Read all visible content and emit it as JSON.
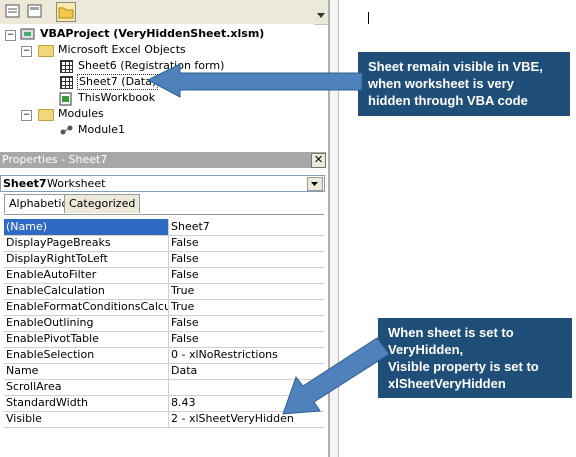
{
  "project_tree": {
    "project": "VBAProject (VeryHiddenSheet.xlsm)",
    "excel_objects_folder": "Microsoft Excel Objects",
    "items": [
      {
        "label": "Sheet6 (Registration form)"
      },
      {
        "label": "Sheet7 (Data)"
      },
      {
        "label": "ThisWorkbook"
      }
    ],
    "modules_folder": "Modules",
    "module": "Module1"
  },
  "properties": {
    "title": "Properties - Sheet7",
    "object_name": "Sheet7",
    "object_type": "Worksheet",
    "tabs": [
      "Alphabetic",
      "Categorized"
    ],
    "rows": [
      {
        "name": "(Name)",
        "value": "Sheet7"
      },
      {
        "name": "DisplayPageBreaks",
        "value": "False"
      },
      {
        "name": "DisplayRightToLeft",
        "value": "False"
      },
      {
        "name": "EnableAutoFilter",
        "value": "False"
      },
      {
        "name": "EnableCalculation",
        "value": "True"
      },
      {
        "name": "EnableFormatConditionsCalculation",
        "value": "True"
      },
      {
        "name": "EnableOutlining",
        "value": "False"
      },
      {
        "name": "EnablePivotTable",
        "value": "False"
      },
      {
        "name": "EnableSelection",
        "value": "0 - xlNoRestrictions"
      },
      {
        "name": "Name",
        "value": "Data"
      },
      {
        "name": "ScrollArea",
        "value": ""
      },
      {
        "name": "StandardWidth",
        "value": "8.43"
      },
      {
        "name": "Visible",
        "value": "2 - xlSheetVeryHidden"
      }
    ]
  },
  "callouts": {
    "top": [
      "Sheet remain visible in VBE,",
      "when worksheet is very",
      "hidden through VBA code"
    ],
    "bottom": [
      "When sheet is set to",
      "VeryHidden,",
      "Visible property is set to",
      "xlSheetVeryHidden"
    ]
  },
  "colors": {
    "callout_bg": "#1f4e79",
    "arrow_fill": "#4f81bd",
    "selection": "#316ac5"
  }
}
